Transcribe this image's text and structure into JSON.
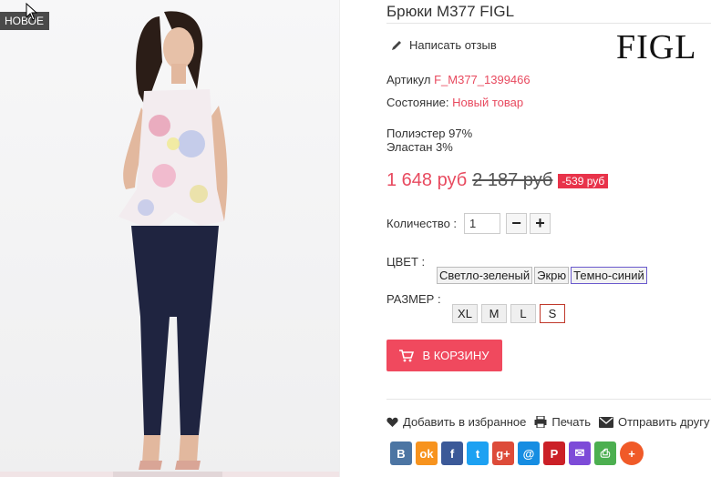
{
  "product": {
    "title": "Брюки M377 FIGL",
    "badge": "НОВОЕ",
    "review_label": "Написать отзыв",
    "brand_logo": "FIGL",
    "sku_label": "Артикул",
    "sku_value": "F_M377_1399466",
    "condition_label": "Состояние:",
    "condition_value": "Новый товар",
    "composition": [
      "Полиэстер 97%",
      "Эластан 3%"
    ],
    "price_now": "1 648 руб",
    "price_old": "2 187 руб",
    "discount": "-539 руб",
    "qty_label": "Количество :",
    "qty_value": "1",
    "qty_minus": "−",
    "qty_plus": "+",
    "color_label": "ЦВЕТ :",
    "colors": [
      "Светло-зеленый",
      "Экрю",
      "Темно-синий"
    ],
    "selected_color": "Темно-синий",
    "size_label": "РАЗМЕР :",
    "sizes": [
      "XL",
      "M",
      "L",
      "S"
    ],
    "selected_size": "S",
    "cart_label": "В КОРЗИНУ"
  },
  "actions": {
    "favorite": "Добавить в избранное",
    "print": "Печать",
    "send": "Отправить другу"
  },
  "social": [
    {
      "name": "vk-icon",
      "glyph": "В",
      "color": "#4c75a3"
    },
    {
      "name": "odnoklassniki-icon",
      "glyph": "ok",
      "color": "#f7931e"
    },
    {
      "name": "facebook-icon",
      "glyph": "f",
      "color": "#3b5998"
    },
    {
      "name": "twitter-icon",
      "glyph": "t",
      "color": "#1da1f2"
    },
    {
      "name": "google-plus-icon",
      "glyph": "g+",
      "color": "#dd4b39"
    },
    {
      "name": "mail-at-icon",
      "glyph": "@",
      "color": "#168de2"
    },
    {
      "name": "pinterest-icon",
      "glyph": "P",
      "color": "#cb2027"
    },
    {
      "name": "email-icon",
      "glyph": "✉",
      "color": "#7d4bd8"
    },
    {
      "name": "print-icon",
      "glyph": "⎙",
      "color": "#4caf50"
    },
    {
      "name": "more-plus-icon",
      "glyph": "+",
      "color": "#f05a28"
    }
  ]
}
